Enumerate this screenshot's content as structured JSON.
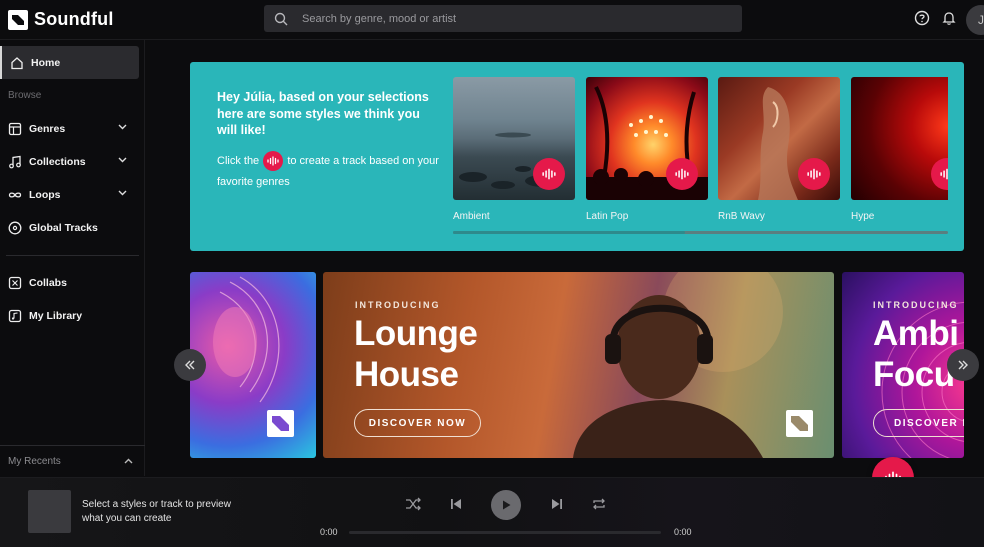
{
  "app": {
    "name": "Soundful"
  },
  "search": {
    "placeholder": "Search by genre, mood or artist"
  },
  "header": {
    "avatar_initial": "J"
  },
  "sidebar": {
    "home": "Home",
    "browse_label": "Browse",
    "genres": "Genres",
    "collections": "Collections",
    "loops": "Loops",
    "global_tracks": "Global Tracks",
    "collabs": "Collabs",
    "my_library": "My Library",
    "my_recents": "My Recents"
  },
  "recommendations": {
    "title": "Hey Júlia, based on your selections here are some styles we think you will like!",
    "sub_before": "Click the",
    "sub_after": "to create a track based on your favorite genres",
    "styles": [
      {
        "label": "Ambient"
      },
      {
        "label": "Latin Pop"
      },
      {
        "label": "RnB Wavy"
      },
      {
        "label": "Hype"
      }
    ]
  },
  "banners": {
    "main": {
      "overline": "INTRODUCING",
      "title_line1": "Lounge",
      "title_line2": "House",
      "button": "DISCOVER NOW"
    },
    "next": {
      "overline": "INTRODUCING",
      "title_line1": "Ambi",
      "title_line2": "Focu",
      "button": "DISCOVER NO"
    }
  },
  "player": {
    "hint": "Select a styles or track to preview what you can create",
    "time_current": "0:00",
    "time_total": "0:00"
  },
  "colors": {
    "accent_pink": "#e5194a",
    "teal_card": "#2ab6b9",
    "background": "#0c0c0e"
  }
}
